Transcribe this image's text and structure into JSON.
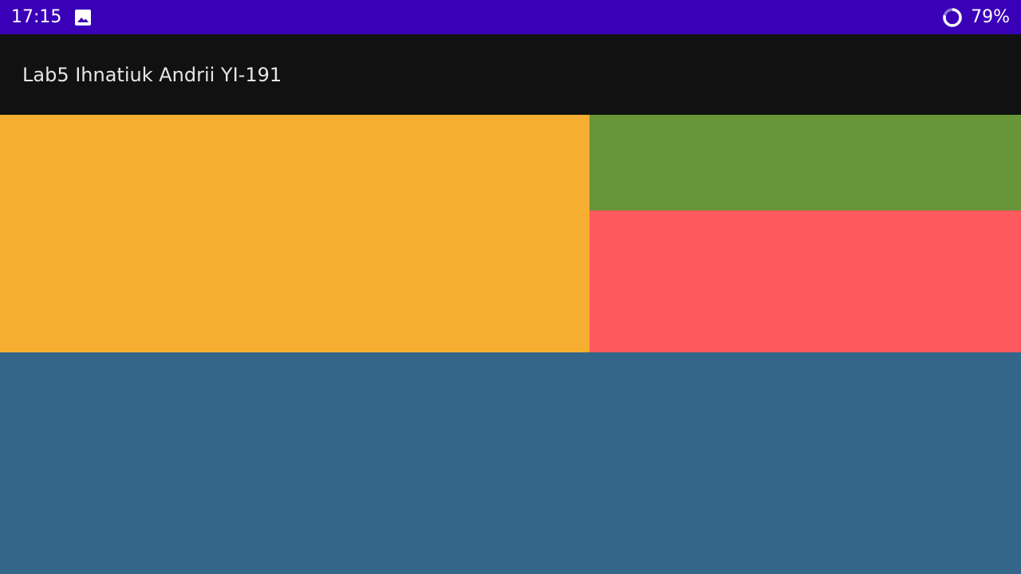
{
  "status_bar": {
    "time": "17:15",
    "battery": "79%",
    "battery_level": 0.79,
    "notification_icon": "image-icon",
    "battery_icon": "battery-ring-icon",
    "background_color": "#3a00b8"
  },
  "app_bar": {
    "title": "Lab5 Ihnatiuk Andrii YI-191",
    "background_color": "#111111"
  },
  "blocks": {
    "left_color": "#f5ae2f",
    "top_right_color": "#689537",
    "bottom_right_color": "#ff5a5e",
    "bottom_color": "#336689"
  }
}
